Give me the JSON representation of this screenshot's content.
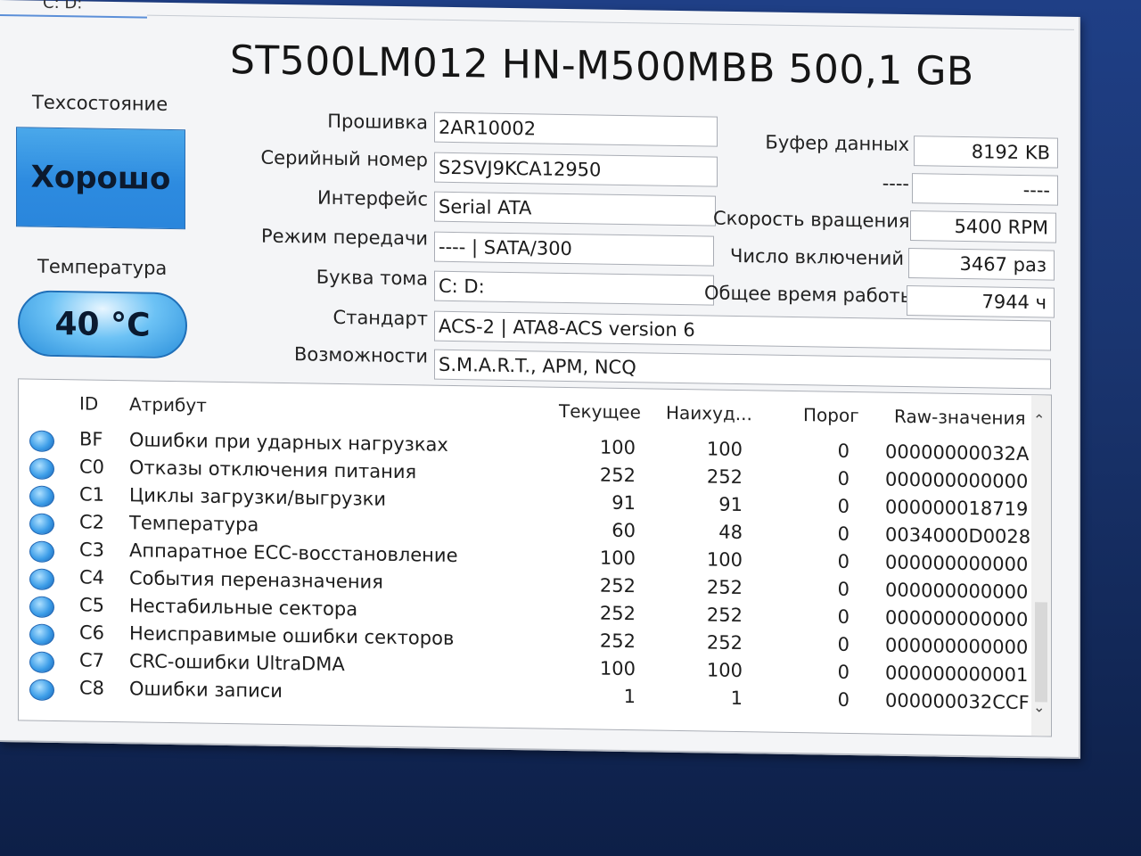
{
  "window": {
    "drive_tab": "C: D:",
    "title": "ST500LM012 HN-M500MBB 500,1 GB"
  },
  "health": {
    "label": "Техсостояние",
    "value": "Хорошо",
    "color": "#3a9be6"
  },
  "temperature": {
    "label": "Температура",
    "value": "40 °C"
  },
  "info": {
    "firmware": {
      "label": "Прошивка",
      "value": "2AR10002"
    },
    "serial": {
      "label": "Серийный номер",
      "value": "S2SVJ9KCA12950"
    },
    "interface": {
      "label": "Интерфейс",
      "value": "Serial ATA"
    },
    "transfer": {
      "label": "Режим передачи",
      "value": "---- | SATA/300"
    },
    "volume": {
      "label": "Буква тома",
      "value": "C: D:"
    },
    "standard": {
      "label": "Стандарт",
      "value": "ACS-2 | ATA8-ACS version 6"
    },
    "features": {
      "label": "Возможности",
      "value": "S.M.A.R.T., APM, NCQ"
    }
  },
  "side": {
    "buffer": {
      "label": "Буфер данных",
      "value": "8192 KB"
    },
    "blank": {
      "label": "----",
      "value": "----"
    },
    "rpm": {
      "label": "Скорость вращения",
      "value": "5400 RPM"
    },
    "power_count": {
      "label": "Число включений",
      "value": "3467 раз"
    },
    "hours": {
      "label": "Общее время работы",
      "value": "7944 ч"
    }
  },
  "table": {
    "headers": {
      "id": "ID",
      "attr": "Атрибут",
      "current": "Текущее",
      "worst": "Наихуд...",
      "threshold": "Порог",
      "raw": "Raw-значения"
    },
    "rows": [
      {
        "id": "BF",
        "attr": "Ошибки при ударных нагрузках",
        "current": "100",
        "worst": "100",
        "threshold": "0",
        "raw": "00000000032A"
      },
      {
        "id": "C0",
        "attr": "Отказы отключения питания",
        "current": "252",
        "worst": "252",
        "threshold": "0",
        "raw": "000000000000"
      },
      {
        "id": "C1",
        "attr": "Циклы загрузки/выгрузки",
        "current": "91",
        "worst": "91",
        "threshold": "0",
        "raw": "000000018719"
      },
      {
        "id": "C2",
        "attr": "Температура",
        "current": "60",
        "worst": "48",
        "threshold": "0",
        "raw": "0034000D0028"
      },
      {
        "id": "C3",
        "attr": "Аппаратное ECC-восстановление",
        "current": "100",
        "worst": "100",
        "threshold": "0",
        "raw": "000000000000"
      },
      {
        "id": "C4",
        "attr": "События переназначения",
        "current": "252",
        "worst": "252",
        "threshold": "0",
        "raw": "000000000000"
      },
      {
        "id": "C5",
        "attr": "Нестабильные сектора",
        "current": "252",
        "worst": "252",
        "threshold": "0",
        "raw": "000000000000"
      },
      {
        "id": "C6",
        "attr": "Неисправимые ошибки секторов",
        "current": "252",
        "worst": "252",
        "threshold": "0",
        "raw": "000000000000"
      },
      {
        "id": "C7",
        "attr": "CRC-ошибки UltraDMA",
        "current": "100",
        "worst": "100",
        "threshold": "0",
        "raw": "000000000001"
      },
      {
        "id": "C8",
        "attr": "Ошибки записи",
        "current": "1",
        "worst": "1",
        "threshold": "0",
        "raw": "000000032CCF"
      }
    ]
  },
  "icons": {
    "status_dot": "status-dot-icon",
    "scroll_up": "chevron-up-icon",
    "scroll_down": "chevron-down-icon"
  }
}
